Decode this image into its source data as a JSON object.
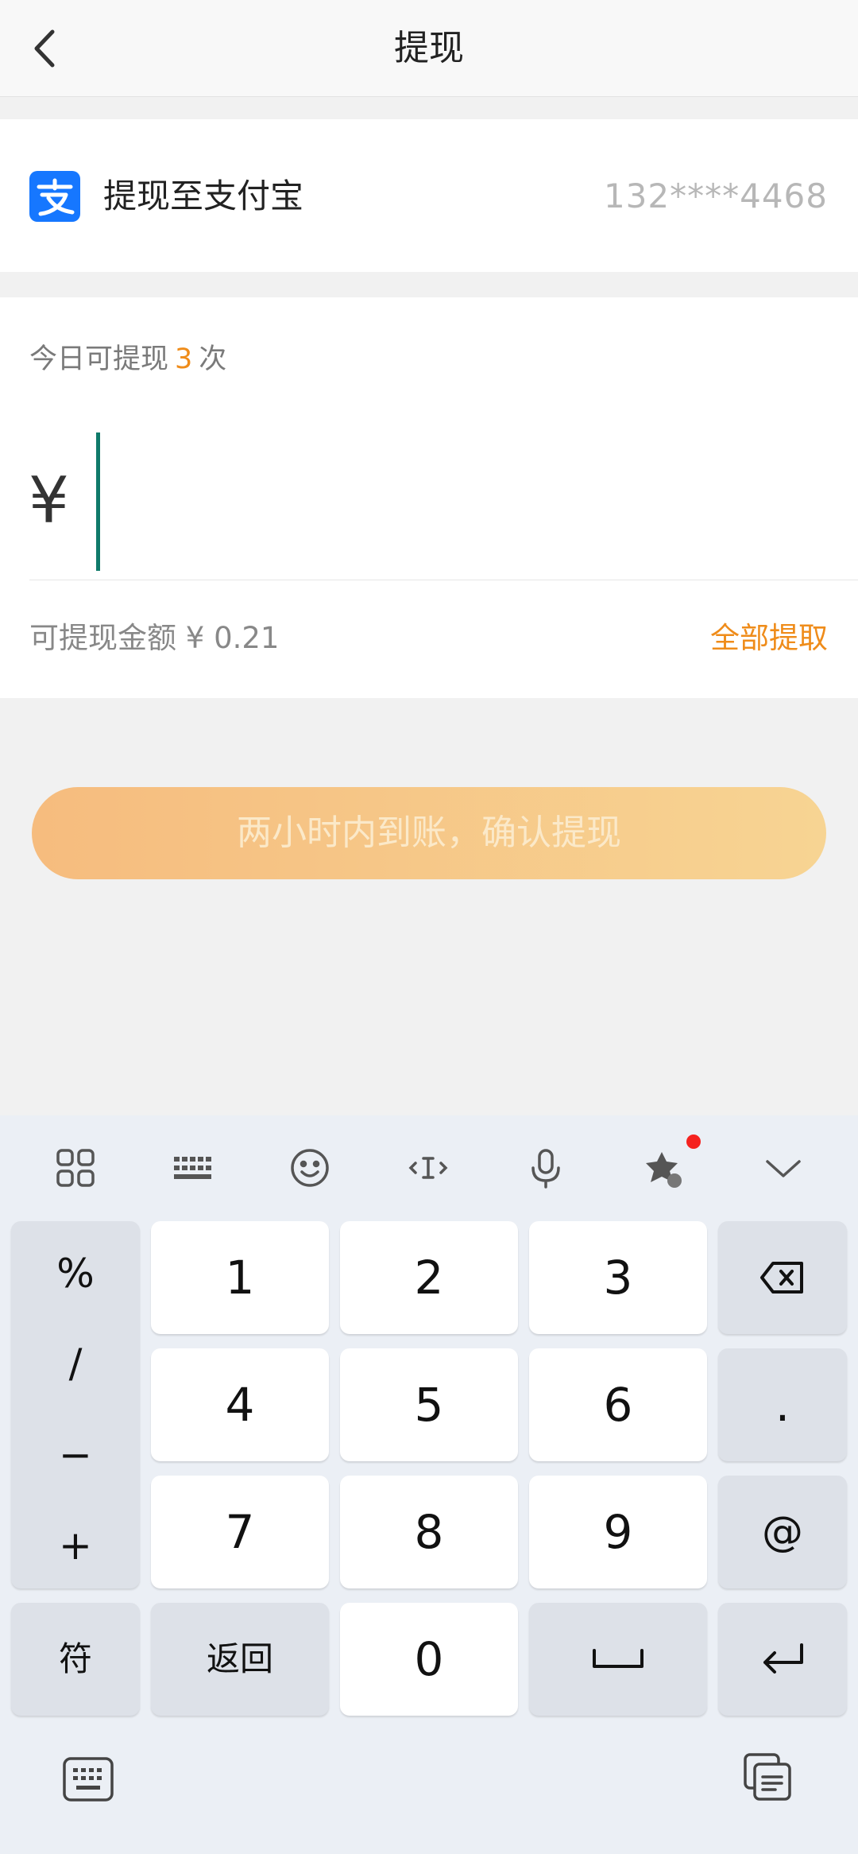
{
  "header": {
    "back_icon": "chevron-left-icon",
    "title": "提现"
  },
  "account": {
    "icon": "alipay-icon",
    "label": "提现至支付宝",
    "number": "132****4468",
    "brand_color": "#1677ff"
  },
  "amount": {
    "count_prefix": "今日可提现",
    "count": "3",
    "count_suffix": "次",
    "currency_symbol": "¥",
    "input_value": "",
    "available_label": "可提现金额 ¥ 0.21",
    "withdraw_all": "全部提取",
    "accent_color": "#ef8c1a"
  },
  "confirm_button": {
    "label": "两小时内到账，确认提现",
    "enabled": false
  },
  "keyboard": {
    "toolbar": [
      {
        "icon": "grid-apps-icon"
      },
      {
        "icon": "keyboard-layout-icon"
      },
      {
        "icon": "emoji-icon"
      },
      {
        "icon": "text-cursor-icon"
      },
      {
        "icon": "microphone-icon"
      },
      {
        "icon": "sticker-icon",
        "badge": true
      },
      {
        "icon": "collapse-chevron-icon"
      }
    ],
    "symbols": [
      "%",
      "/",
      "−",
      "+"
    ],
    "digits": [
      "1",
      "2",
      "3",
      "4",
      "5",
      "6",
      "7",
      "8",
      "9",
      "0"
    ],
    "right_keys": {
      "delete_icon": "backspace-icon",
      "dot": ".",
      "at": "@",
      "enter_icon": "enter-icon"
    },
    "bottom_row": {
      "symbols_label": "符",
      "back_label": "返回",
      "space_icon": "space-icon"
    },
    "bottom_bar": {
      "left_icon": "keyboard-switch-icon",
      "right_icon": "clipboard-icon"
    }
  }
}
